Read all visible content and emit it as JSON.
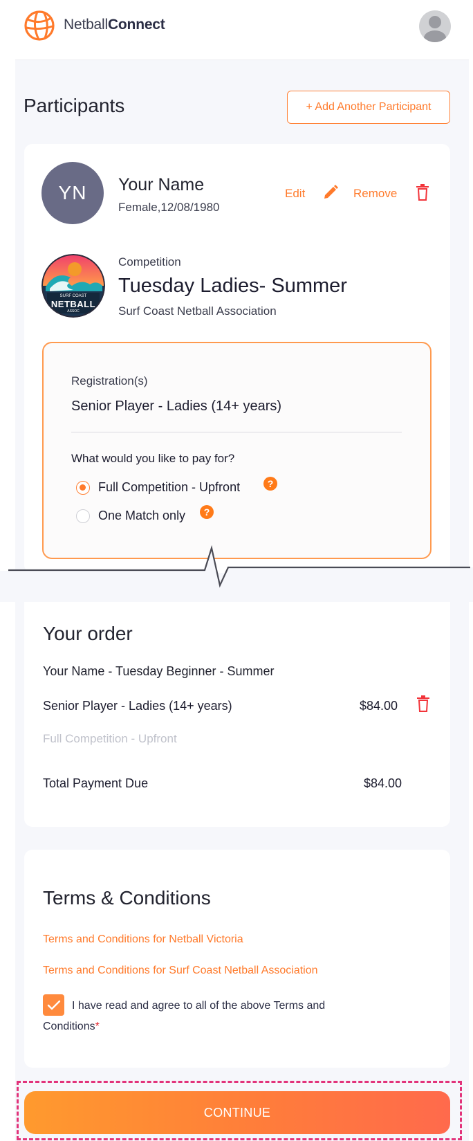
{
  "header": {
    "brand_prefix": "Netball",
    "brand_suffix": "Connect"
  },
  "participants": {
    "title": "Participants",
    "add_button": "+ Add Another Participant",
    "participant": {
      "initials": "YN",
      "name": "Your Name",
      "meta": "Female,12/08/1980",
      "edit_label": "Edit",
      "remove_label": "Remove"
    },
    "competition": {
      "label": "Competition",
      "name": "Tuesday Ladies- Summer",
      "association": "Surf Coast Netball Association",
      "logo_text_top": "SURF COAST",
      "logo_text_main": "NETBALL",
      "logo_text_bottom": "ASSOC"
    },
    "registration": {
      "label": "Registration(s)",
      "value": "Senior Player - Ladies (14+ years)",
      "pay_question": "What would you like to pay for?",
      "options": [
        {
          "label": "Full Competition - Upfront",
          "selected": true
        },
        {
          "label": "One Match only",
          "selected": false
        }
      ],
      "help_glyph": "?"
    }
  },
  "order": {
    "title": "Your order",
    "line": "Your Name - Tuesday Beginner - Summer",
    "item_label": "Senior Player - Ladies (14+ years)",
    "item_price": "$84.00",
    "item_sub": "Full Competition - Upfront",
    "total_label": "Total Payment Due",
    "total_value": "$84.00"
  },
  "terms": {
    "title": "Terms & Conditions",
    "link1": "Terms and Conditions for Netball Victoria",
    "link2": "Terms and Conditions for Surf Coast Netball Association",
    "agree_line1": "I have read and agree to all of the above Terms and",
    "agree_line2": "Conditions",
    "required_mark": "*",
    "checked": true
  },
  "continue_label": "CONTINUE",
  "colors": {
    "accent": "#ff7a2b",
    "avatar_bg": "#696b86",
    "highlight_dash": "#e2337a"
  },
  "icons": [
    "netball-logo-icon",
    "user-avatar-icon",
    "pencil-icon",
    "trash-icon",
    "help-icon",
    "check-icon"
  ]
}
